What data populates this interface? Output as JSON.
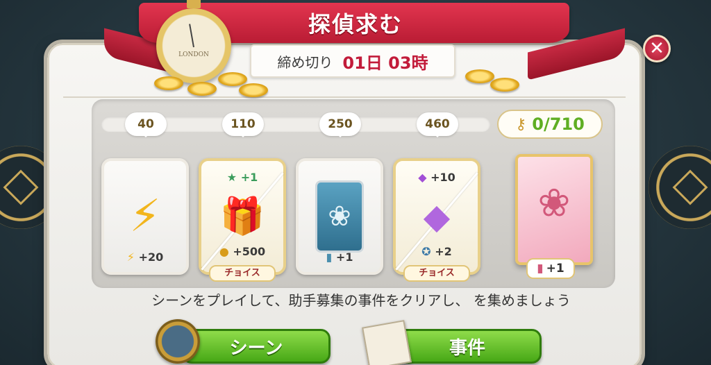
{
  "title": "探偵求む",
  "deadline": {
    "label": "締め切り",
    "value": "01日 03時"
  },
  "stopwatch": {
    "face_text": "LONDON"
  },
  "progress": {
    "current": 0,
    "max": 710,
    "counter_text": "0/710",
    "milestones": [
      "40",
      "110",
      "250",
      "460"
    ]
  },
  "rewards": [
    {
      "top": "",
      "bottom": "+20",
      "bottom_icon": "energy-icon",
      "choice": ""
    },
    {
      "top": "+1",
      "bottom": "+500",
      "top_icon": "star-badge-icon",
      "bottom_icon": "coin-icon",
      "choice": "チョイス"
    },
    {
      "top": "",
      "bottom": "+1",
      "bottom_icon": "card-icon",
      "choice": ""
    },
    {
      "top": "+10",
      "bottom": "+2",
      "top_icon": "gem-icon",
      "bottom_icon": "compass-icon",
      "choice": "チョイス"
    }
  ],
  "final_reward": {
    "label": "+1"
  },
  "instruction": "シーンをプレイして、助手募集の事件をクリアし、 を集めましょう",
  "buttons": {
    "scene": "シーン",
    "case": "事件"
  },
  "colors": {
    "ribbon": "#c8233c",
    "accent_green": "#5fae23",
    "gold": "#e8d08a"
  }
}
